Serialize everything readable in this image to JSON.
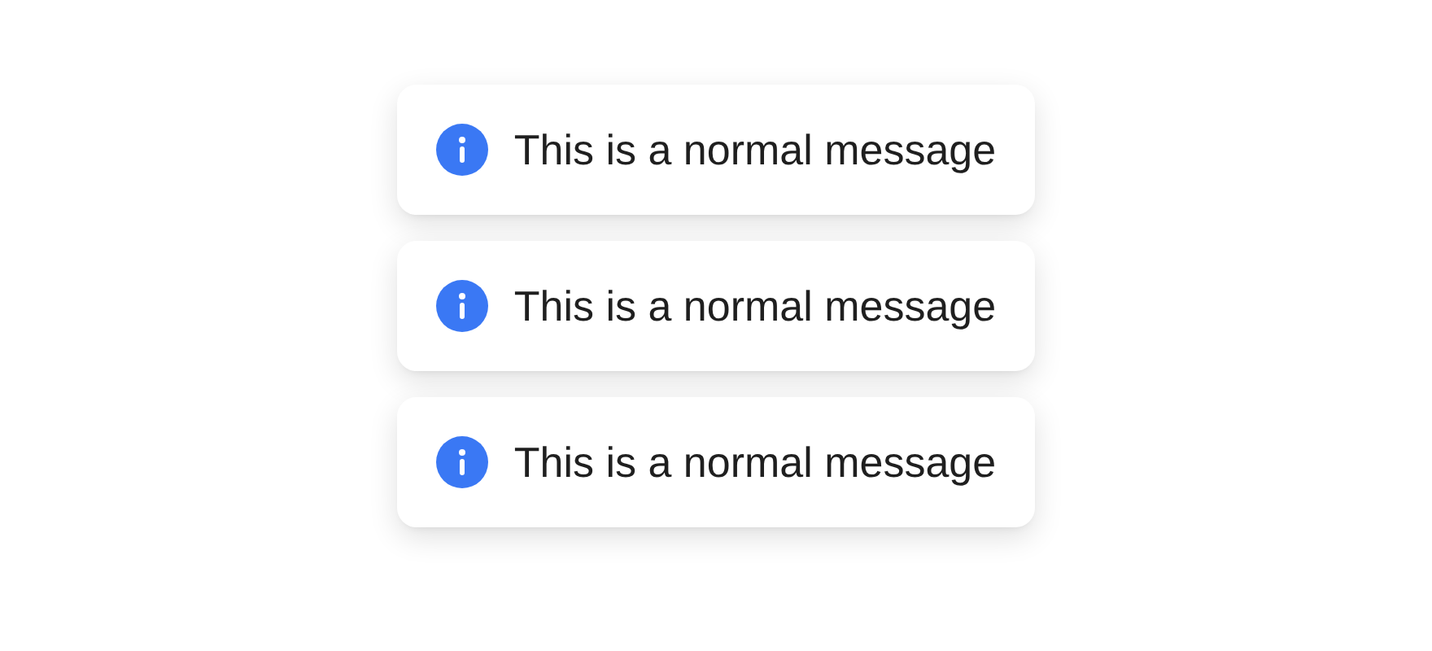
{
  "messages": [
    {
      "kind": "info",
      "text": "This is a normal message"
    },
    {
      "kind": "info",
      "text": "This is a normal message"
    },
    {
      "kind": "info",
      "text": "This is a normal message"
    }
  ]
}
